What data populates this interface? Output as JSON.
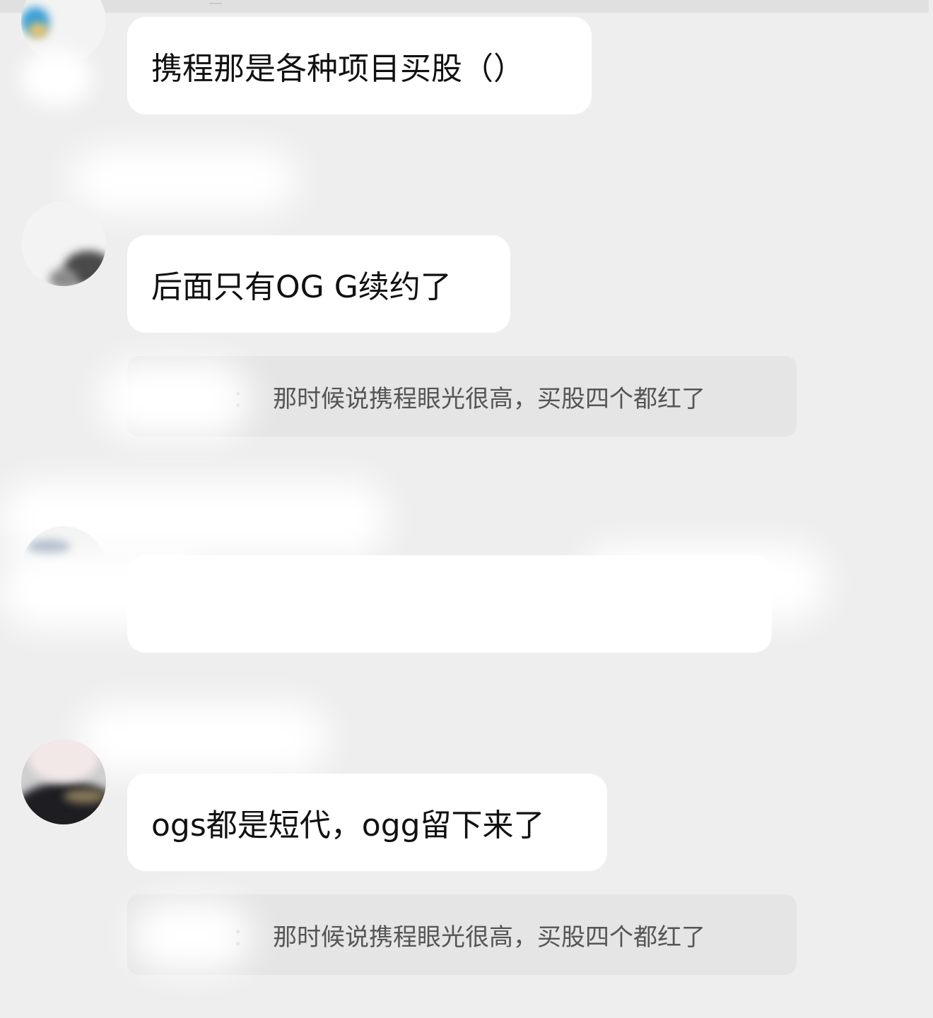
{
  "messages": [
    {
      "text": "携程那是各种项目买股（）"
    },
    {
      "text": "后面只有OG G续约了"
    },
    {
      "text": ""
    },
    {
      "text": "ogs都是短代，ogg留下来了"
    }
  ],
  "quotes": [
    {
      "separator": "：",
      "text": "那时候说携程眼光很高，买股四个都红了"
    },
    {
      "separator": "：",
      "text": "那时候说携程眼光很高，买股四个都红了"
    }
  ]
}
